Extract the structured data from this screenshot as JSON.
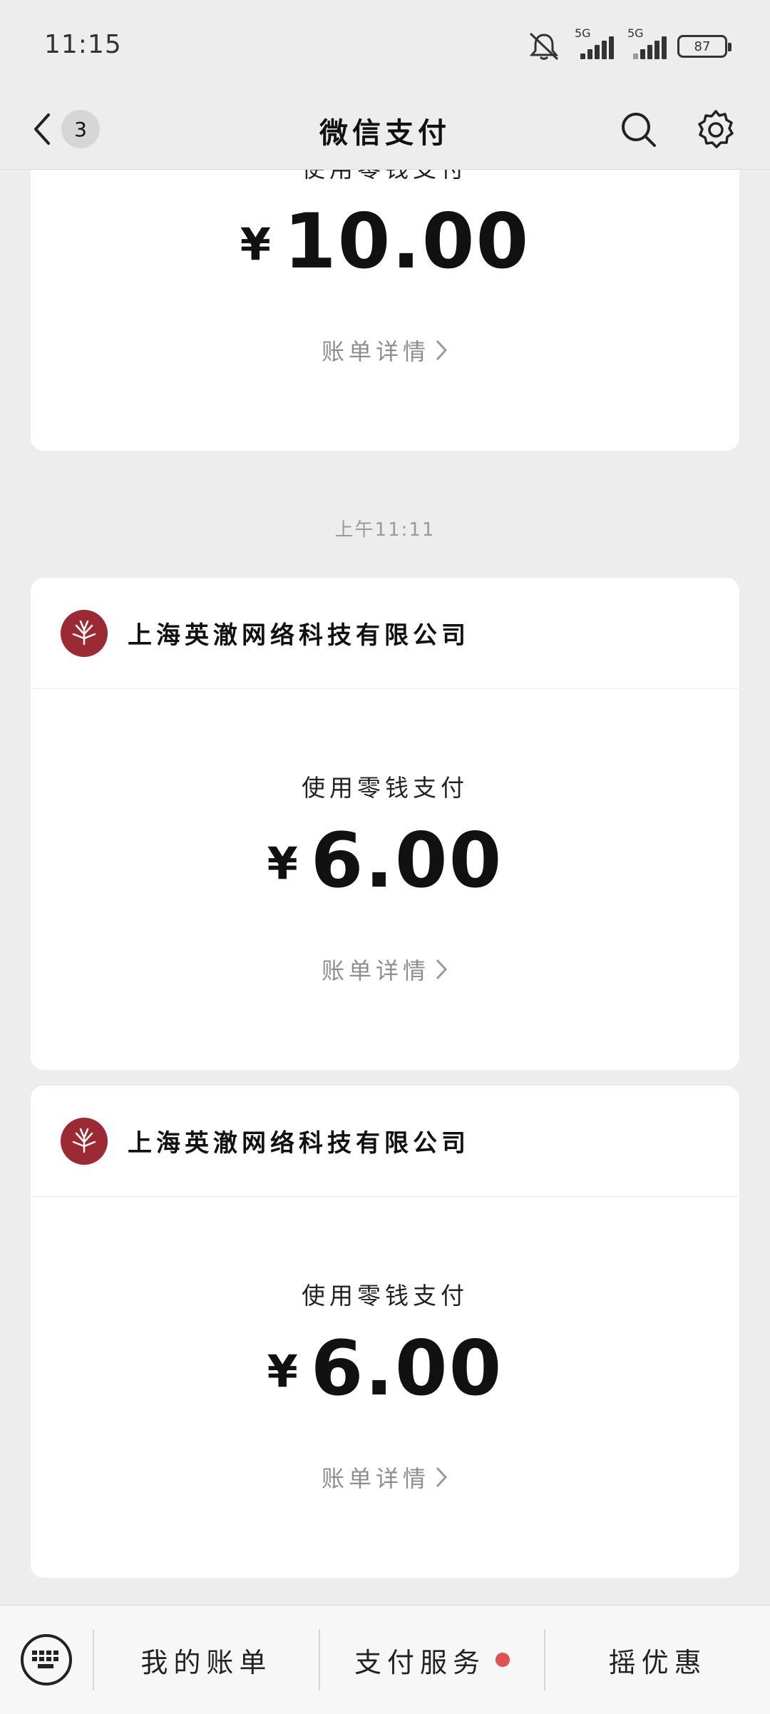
{
  "status_bar": {
    "time": "11:15",
    "network_1": "5G",
    "network_2": "5G",
    "battery": "87",
    "icons": [
      "mute-icon",
      "signal-icon",
      "signal-icon",
      "battery-icon"
    ]
  },
  "nav": {
    "back_badge": "3",
    "title": "微信支付",
    "icons": [
      "back-icon",
      "search-icon",
      "gear-icon"
    ]
  },
  "messages": [
    {
      "pay_method": "使用零钱支付",
      "currency": "¥",
      "amount": "10.00",
      "detail_label": "账单详情"
    },
    {
      "timestamp": "上午11:11",
      "merchant": "上海英澈网络科技有限公司",
      "pay_method": "使用零钱支付",
      "currency": "¥",
      "amount": "6.00",
      "detail_label": "账单详情"
    },
    {
      "merchant": "上海英澈网络科技有限公司",
      "pay_method": "使用零钱支付",
      "currency": "¥",
      "amount": "6.00",
      "detail_label": "账单详情"
    }
  ],
  "bottom_menu": {
    "items": [
      "我的账单",
      "支付服务",
      "摇优惠"
    ],
    "dot_color": "#e05252",
    "keyboard_icon": "keyboard-icon"
  },
  "colors": {
    "background": "#ededed",
    "logo": "#9b2a35",
    "muted_text": "#8e8e8e"
  }
}
